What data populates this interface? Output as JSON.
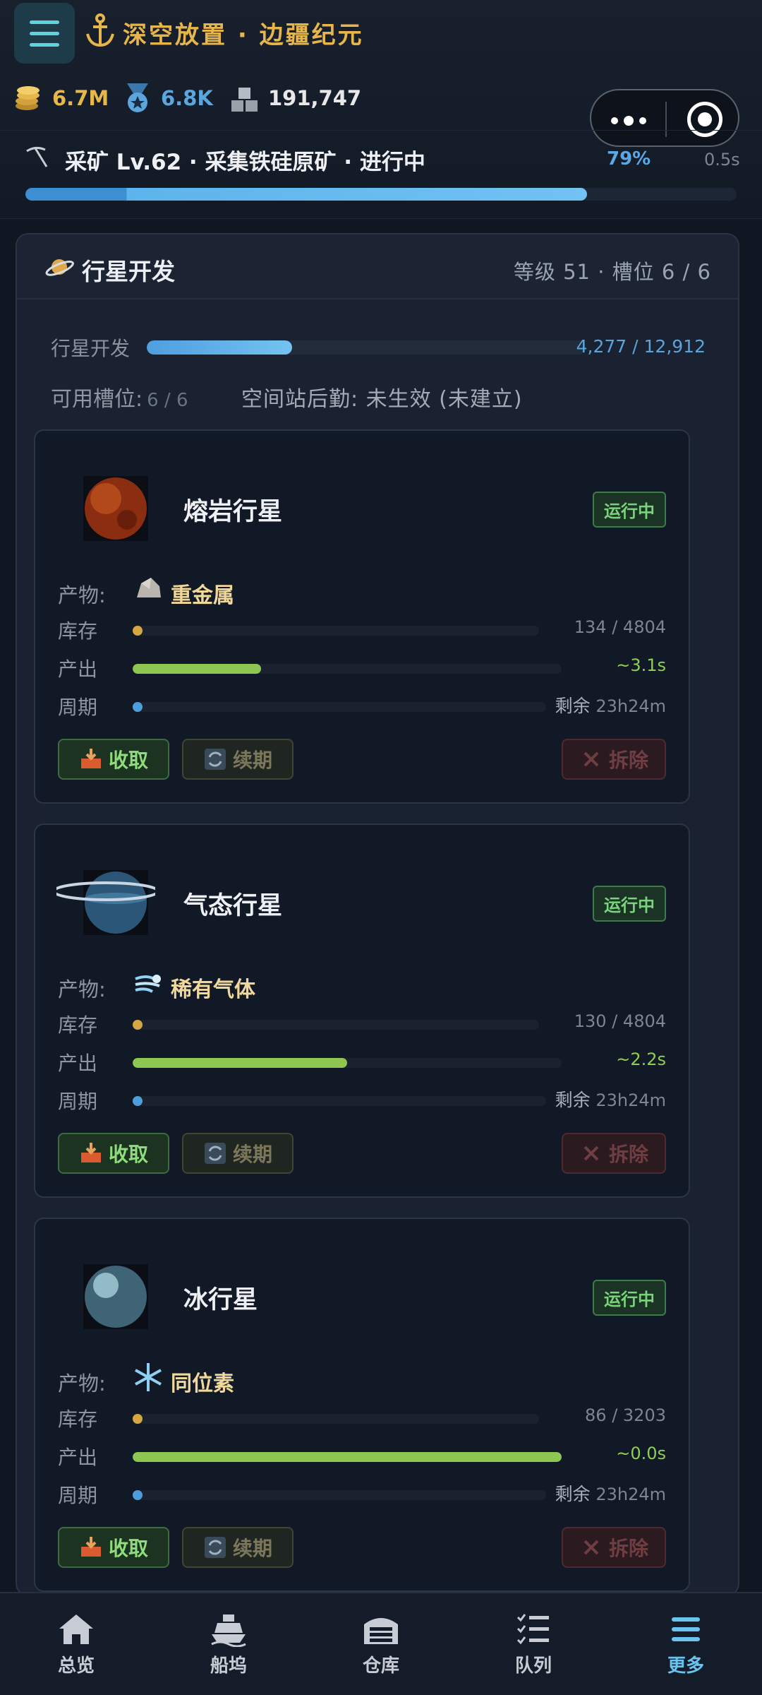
{
  "header": {
    "title": "深空放置 · 边疆纪元",
    "resources": [
      {
        "icon": "coins-icon",
        "value": "6.7M",
        "color": "#e6b84c"
      },
      {
        "icon": "medal-icon",
        "value": "6.8K",
        "color": "#5ba6dc"
      },
      {
        "icon": "cargo-icon",
        "value": "191,747",
        "color": "#e8e8e8"
      }
    ]
  },
  "task": {
    "label": "采矿 Lv.62 · 采集铁硅原矿 · 进行中",
    "percent_text": "79%",
    "progress": 0.79,
    "time": "0.5s"
  },
  "panel": {
    "title": "行星开发",
    "meta": "等级 51 · 槽位 6 / 6",
    "dev_label": "行星开发",
    "dev_value": "4,277 / 12,912",
    "dev_progress": 0.331,
    "slots_label": "可用槽位:",
    "slots_value": "6 / 6",
    "station_label": "空间站后勤: 未生效 (未建立)"
  },
  "labels": {
    "product": "产物:",
    "stock": "库存",
    "output": "产出",
    "cycle": "周期",
    "remaining": "剩余",
    "collect": "收取",
    "renew": "续期",
    "demolish": "拆除",
    "running": "运行中"
  },
  "planets": [
    {
      "name": "熔岩行星",
      "status": "运行中",
      "product": "重金属",
      "product_icon": "rock-icon",
      "stock": "134 / 4804",
      "stock_ratio": 0.028,
      "output": "~3.1s",
      "output_ratio": 0.3,
      "cycle": "23h24m",
      "cycle_ratio": 0.01
    },
    {
      "name": "气态行星",
      "status": "运行中",
      "product": "稀有气体",
      "product_icon": "gas-icon",
      "stock": "130 / 4804",
      "stock_ratio": 0.027,
      "output": "~2.2s",
      "output_ratio": 0.5,
      "cycle": "23h24m",
      "cycle_ratio": 0.01
    },
    {
      "name": "冰行星",
      "status": "运行中",
      "product": "同位素",
      "product_icon": "snowflake-icon",
      "stock": "86 / 3203",
      "stock_ratio": 0.027,
      "output": "~0.0s",
      "output_ratio": 1.0,
      "cycle": "23h24m",
      "cycle_ratio": 0.01
    }
  ],
  "nav": [
    {
      "label": "总览",
      "icon": "home-icon"
    },
    {
      "label": "船坞",
      "icon": "ship-icon"
    },
    {
      "label": "仓库",
      "icon": "warehouse-icon"
    },
    {
      "label": "队列",
      "icon": "checklist-icon"
    },
    {
      "label": "更多",
      "icon": "menu-icon",
      "active": true
    }
  ]
}
